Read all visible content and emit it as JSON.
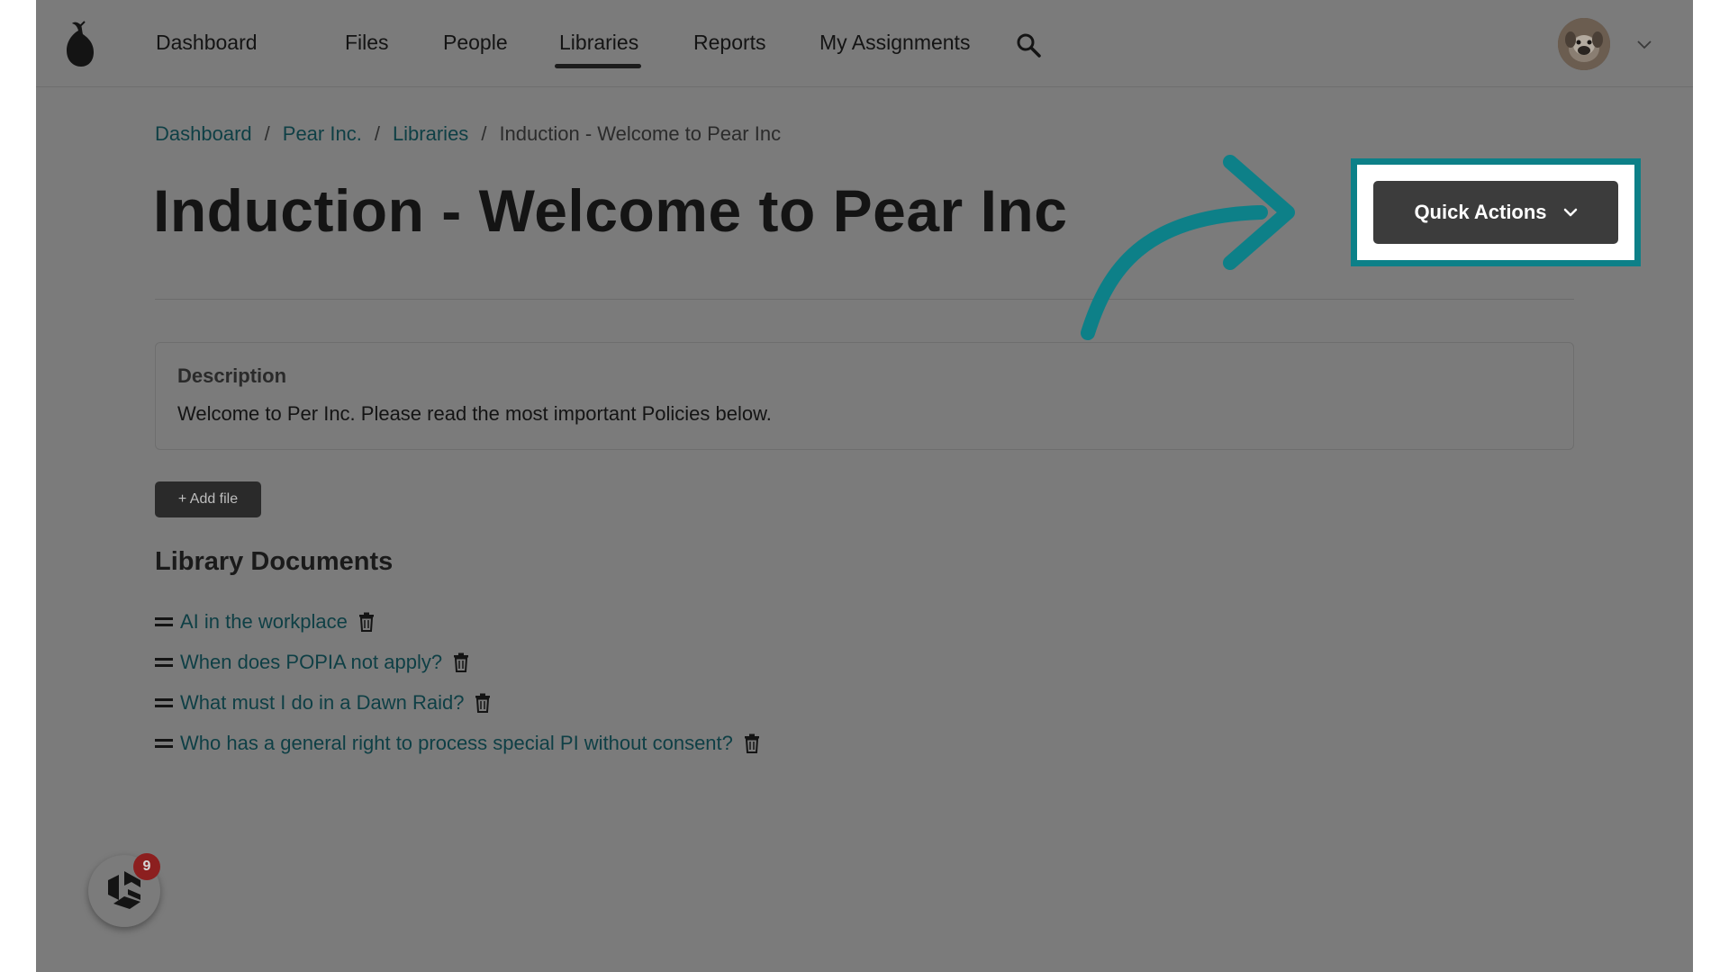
{
  "nav": {
    "items": [
      {
        "label": "Dashboard"
      },
      {
        "label": "Files"
      },
      {
        "label": "People"
      },
      {
        "label": "Libraries",
        "active": true
      },
      {
        "label": "Reports"
      },
      {
        "label": "My Assignments"
      }
    ]
  },
  "breadcrumb": {
    "items": [
      "Dashboard",
      "Pear Inc.",
      "Libraries"
    ],
    "separator": "/",
    "current": "Induction - Welcome to Pear Inc"
  },
  "page": {
    "title": "Induction - Welcome to Pear Inc"
  },
  "quick_actions": {
    "label": "Quick Actions"
  },
  "description": {
    "heading": "Description",
    "text": "Welcome to Per Inc. Please read the most important Policies below."
  },
  "add_file": {
    "label": "+ Add file"
  },
  "library": {
    "heading": "Library Documents",
    "documents": [
      "AI in the workplace",
      "When does POPIA not apply?",
      "What must I do in a Dawn Raid?",
      "Who has a general right to process special PI without consent?"
    ]
  },
  "widget": {
    "badge_count": "9"
  },
  "colors": {
    "highlight": "#0d8088",
    "overlay_background": "#7b7b7b",
    "link": "#0e3f45",
    "badge": "#8c1f1f"
  },
  "icons": {
    "logo": "pear-logo-icon",
    "search": "search-icon",
    "avatar_menu": "chevron-down-icon",
    "drag": "drag-handle-icon",
    "delete": "trash-icon",
    "quick_actions": "chevron-down-icon",
    "widget": "widget-logo-icon",
    "annotation": "curved-arrow-icon"
  }
}
